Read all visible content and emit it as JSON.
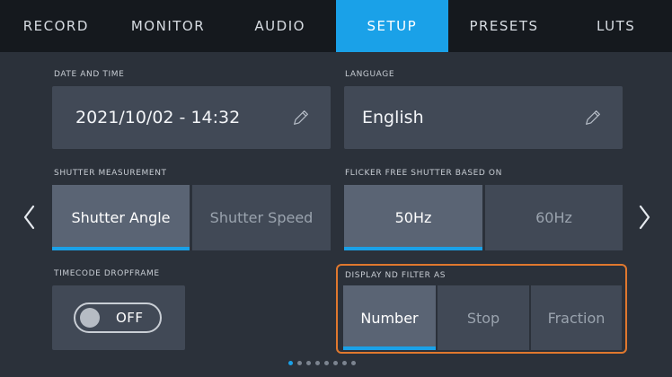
{
  "tabs": [
    "RECORD",
    "MONITOR",
    "AUDIO",
    "SETUP",
    "PRESETS",
    "LUTS"
  ],
  "active_tab": "SETUP",
  "accent_color": "#1aa1e8",
  "highlight_color": "#e0782e",
  "date_time": {
    "label": "DATE AND TIME",
    "value": "2021/10/02 - 14:32"
  },
  "language": {
    "label": "LANGUAGE",
    "value": "English"
  },
  "shutter_measurement": {
    "label": "SHUTTER MEASUREMENT",
    "options": [
      "Shutter Angle",
      "Shutter Speed"
    ],
    "selected": "Shutter Angle"
  },
  "flicker_free": {
    "label": "FLICKER FREE SHUTTER BASED ON",
    "options": [
      "50Hz",
      "60Hz"
    ],
    "selected": "50Hz"
  },
  "timecode_dropframe": {
    "label": "TIMECODE DROPFRAME",
    "state": "OFF"
  },
  "nd_filter": {
    "label": "DISPLAY ND FILTER AS",
    "options": [
      "Number",
      "Stop",
      "Fraction"
    ],
    "selected": "Number"
  },
  "page_indicator": {
    "total": 8,
    "current": 1
  }
}
